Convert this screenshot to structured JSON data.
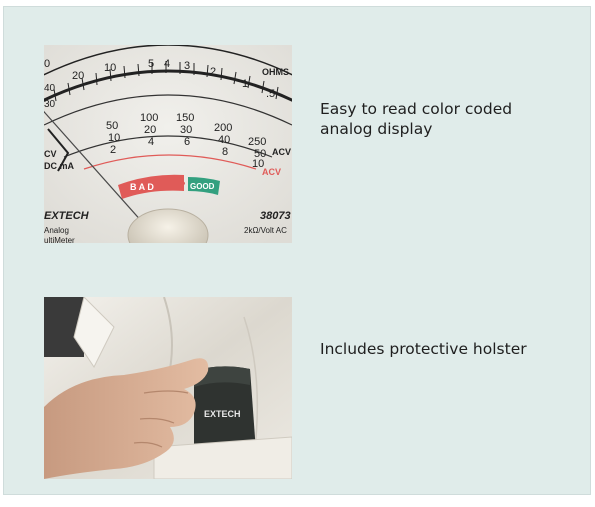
{
  "features": [
    {
      "caption_lines": [
        "Easy to read color coded",
        "analog display"
      ],
      "image": {
        "meter_brand": "EXTECH",
        "meter_type_lines": [
          "Analog",
          "ultiMeter"
        ],
        "model_partial": "38073",
        "sensitivity": "2kΩ/Volt AC",
        "scale_labels": {
          "ohms": "OHMS",
          "top_scale": [
            "0",
            "20",
            "10",
            "5",
            "4",
            "3",
            "2",
            "1",
            ".5"
          ],
          "top_left": [
            "40",
            "30"
          ],
          "mid_scale": [
            "50",
            "10",
            "100",
            "20",
            "150",
            "30",
            "200",
            "40",
            "250",
            "50"
          ],
          "low_scale": [
            "2",
            "4",
            "6",
            "8",
            "10"
          ],
          "acv": "ACV",
          "acv_red": "ACV",
          "left_labels": [
            "CV",
            "DC mA"
          ],
          "bad": "B A D",
          "good": "GOOD",
          "question": "?"
        }
      }
    },
    {
      "caption_lines": [
        "Includes protective holster"
      ],
      "image": {
        "holster_brand": "EXTECH"
      }
    }
  ],
  "colors": {
    "panel_background": "#e0ecea",
    "bad_red": "#e05b58",
    "good_green": "#33a07f"
  }
}
